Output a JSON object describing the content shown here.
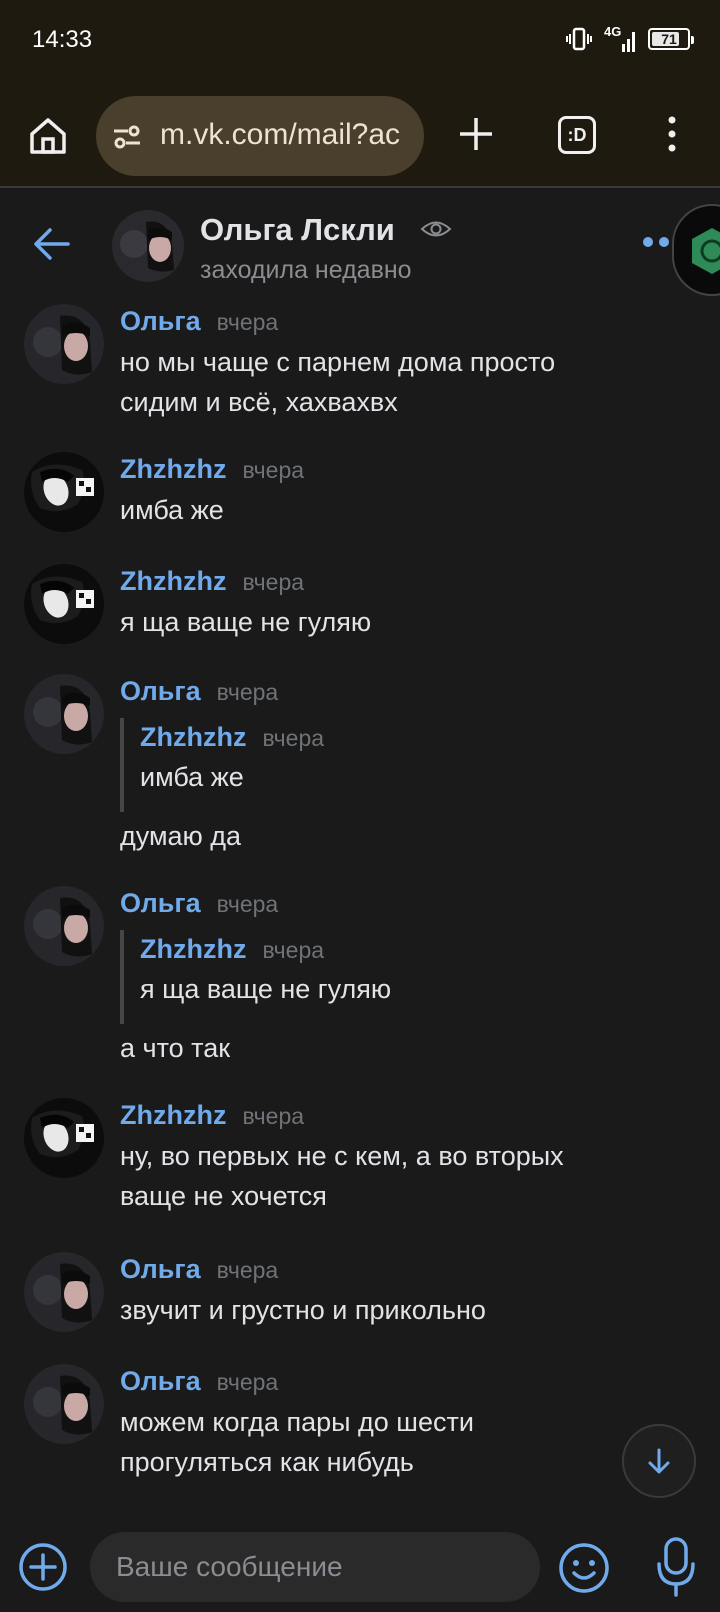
{
  "status_bar": {
    "time": "14:33",
    "network": "4G",
    "battery": "71"
  },
  "browser": {
    "url": "m.vk.com/mail?ac",
    "tabs_label": ":D"
  },
  "chat": {
    "name": "Ольга Лскли",
    "status": "заходила недавно"
  },
  "colors": {
    "accent": "#71aaeb",
    "background": "#1a1a1a",
    "browser_bar": "#1f1a10"
  },
  "messages": [
    {
      "author": "Ольга",
      "time": "вчера",
      "lines": [
        "но мы чаще с парнем дома просто",
        "сидим и всё, хахвахвх"
      ]
    },
    {
      "author": "Zhzhzhz",
      "time": "вчера",
      "lines": [
        "имба же"
      ]
    },
    {
      "author": "Zhzhzhz",
      "time": "вчера",
      "lines": [
        "я ща ваще не гуляю"
      ]
    },
    {
      "author": "Ольга",
      "time": "вчера",
      "quote": {
        "author": "Zhzhzhz",
        "time": "вчера",
        "text": "имба же"
      },
      "lines": [
        "думаю да"
      ]
    },
    {
      "author": "Ольга",
      "time": "вчера",
      "quote": {
        "author": "Zhzhzhz",
        "time": "вчера",
        "text": "я ща ваще не гуляю"
      },
      "lines": [
        "а что так"
      ]
    },
    {
      "author": "Zhzhzhz",
      "time": "вчера",
      "lines": [
        "ну, во первых не с кем, а во вторых",
        "ваще не хочется"
      ]
    },
    {
      "author": "Ольга",
      "time": "вчера",
      "lines": [
        "звучит и грустно и прикольно"
      ]
    },
    {
      "author": "Ольга",
      "time": "вчера",
      "lines": [
        "можем когда пары до шести",
        "прогуляться как нибудь"
      ]
    }
  ],
  "composer": {
    "placeholder": "Ваше сообщение"
  }
}
